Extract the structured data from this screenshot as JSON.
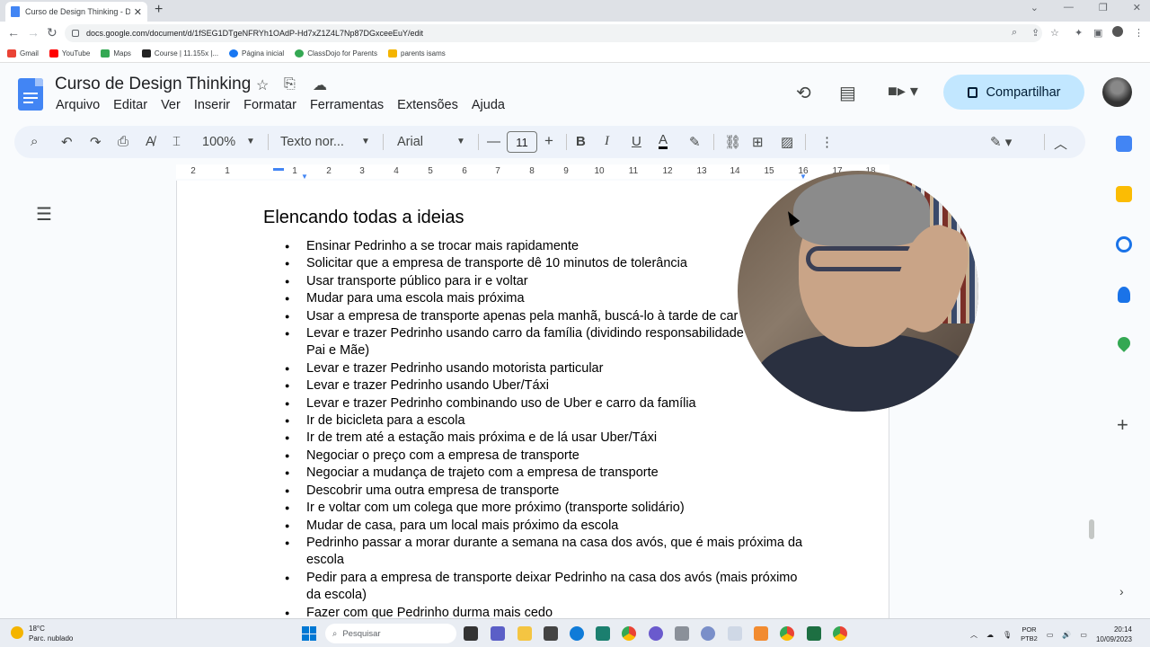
{
  "browser": {
    "tab_title": "Curso de Design Thinking - Docs",
    "url": "docs.google.com/document/d/1fSEG1DTgeNFRYh1OAdP-Hd7xZ1Z4L7Np87DGxceeEuY/edit",
    "bookmarks": [
      {
        "label": "Gmail",
        "color": "#ea4335"
      },
      {
        "label": "YouTube",
        "color": "#ff0000"
      },
      {
        "label": "Maps",
        "color": "#34a853"
      },
      {
        "label": "Course | 11.155x |...",
        "color": "#222222"
      },
      {
        "label": "Página inicial",
        "color": "#1877f2"
      },
      {
        "label": "ClassDojo for Parents",
        "color": "#34a853"
      },
      {
        "label": "parents isams",
        "color": "#f4b400"
      }
    ]
  },
  "docs": {
    "title": "Curso de Design Thinking",
    "menu": [
      "Arquivo",
      "Editar",
      "Ver",
      "Inserir",
      "Formatar",
      "Ferramentas",
      "Extensões",
      "Ajuda"
    ],
    "share_label": "Compartilhar",
    "toolbar": {
      "zoom": "100%",
      "style": "Texto nor...",
      "font": "Arial",
      "font_size": "11"
    },
    "ruler_ticks": [
      "2",
      "1",
      "1",
      "2",
      "3",
      "4",
      "5",
      "6",
      "7",
      "8",
      "9",
      "10",
      "11",
      "12",
      "13",
      "14",
      "15",
      "16",
      "17",
      "18"
    ]
  },
  "document": {
    "heading": "Elencando todas a ideias",
    "ideas": [
      "Ensinar Pedrinho a se trocar mais rapidamente",
      "Solicitar que a empresa de transporte dê 10 minutos de tolerância",
      "Usar transporte público para ir e voltar",
      "Mudar para uma escola mais próxima",
      "Usar a empresa de transporte apenas pela manhã, buscá-lo à tarde de car",
      "Levar e trazer Pedrinho usando carro da família (dividindo responsabilidade Pai e Mãe)",
      "Levar e trazer Pedrinho usando motorista particular",
      "Levar e trazer Pedrinho usando Uber/Táxi",
      "Levar e trazer Pedrinho combinando uso de Uber e carro da família",
      "Ir de bicicleta para a escola",
      "Ir de trem até a estação mais próxima e de lá usar Uber/Táxi",
      "Negociar o preço com a empresa de transporte",
      "Negociar a mudança de trajeto com a empresa de transporte",
      "Descobrir uma outra empresa de transporte",
      "Ir e voltar com um colega que more próximo (transporte solidário)",
      "Mudar de casa, para um local mais próximo da escola",
      "Pedrinho passar a morar durante a semana na casa dos avós, que é mais próxima da escola",
      "Pedir para a empresa de transporte deixar Pedrinho na casa dos avós (mais próximo da escola)",
      "Fazer com que Pedrinho durma mais cedo"
    ]
  },
  "taskbar": {
    "weather_temp": "18°C",
    "weather_desc": "Parc. nublado",
    "search_placeholder": "Pesquisar",
    "lang_line1": "POR",
    "lang_line2": "PTB2",
    "time": "20:14",
    "date": "10/09/2023"
  }
}
